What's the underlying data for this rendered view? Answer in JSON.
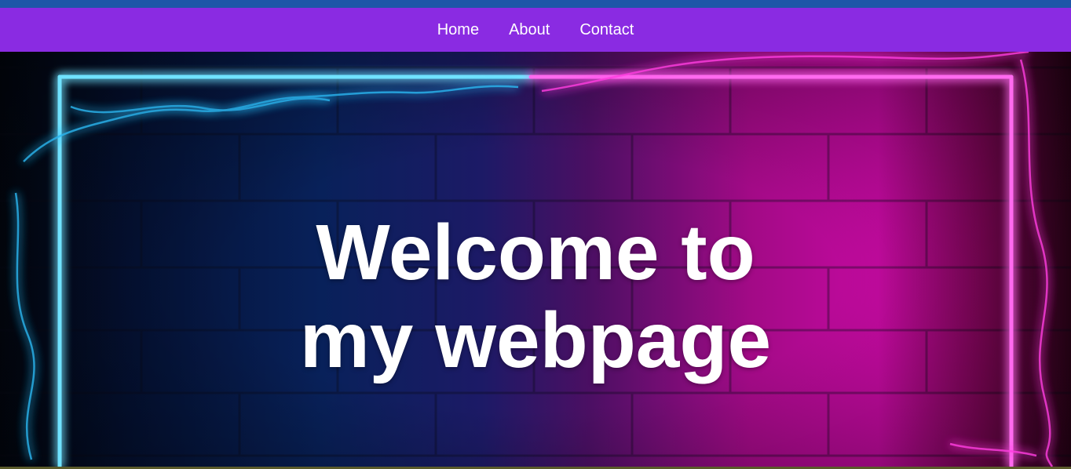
{
  "nav": {
    "items": [
      {
        "label": "Home"
      },
      {
        "label": "About"
      },
      {
        "label": "Contact"
      }
    ]
  },
  "hero": {
    "headline_line1": "Welcome to",
    "headline_line2": "my webpage"
  },
  "colors": {
    "topstrip": "#1e56a8",
    "navbar": "#8a2be2",
    "neon_blue": "#29c6ff",
    "neon_pink": "#ff2fd6"
  }
}
